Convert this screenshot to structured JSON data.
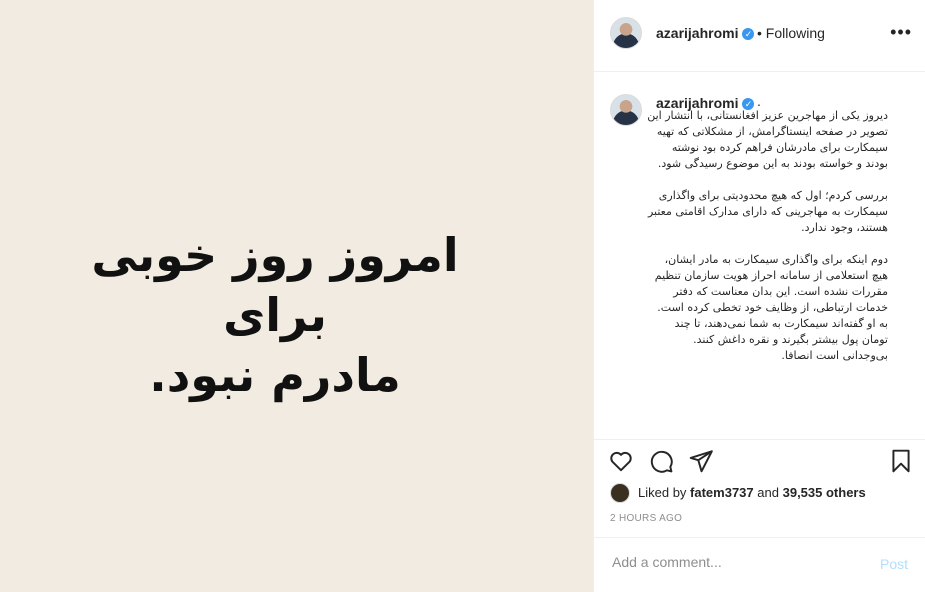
{
  "image": {
    "lines": [
      "امروز روز خوبی برای",
      "مادرم نبود."
    ],
    "background": "#f1ebe1"
  },
  "header": {
    "username": "azarijahromi",
    "separator": "•",
    "follow_state": "Following",
    "more_icon": "ellipsis-icon"
  },
  "caption": {
    "username": "azarijahromi",
    "dot": ".",
    "paragraphs": [
      "دیروز یکی از مهاجرین عزیز افغانستانی، با انتشار این تصویر در صفحه اینستاگرامش، از مشکلاتی که تهیه سیمکارت برای مادرشان فراهم کرده بود نوشته بودند و خواسته بودند به این موضوع رسیدگی شود.",
      "بررسی کردم؛ اول که هیچ محدودیتی برای واگذاری سیمکارت به مهاجرینی که دارای مدارک اقامتی معتبر هستند، وجود ندارد.",
      "دوم اینکه برای واگذاری سیمکارت به مادر ایشان، هیچ استعلامی از سامانه احراز هویت سازمان تنظیم مقررات نشده است. این بدان معناست که دفتر خدمات ارتباطی، از وظایف خود تخطی کرده است. به او گفته‌اند سیمکارت به شما نمی‌دهند، تا چند تومان پول بیشتر بگیرند و نقره داغش کنند. بی‌وجدانی است انصافا."
    ]
  },
  "actions": {
    "like_icon": "heart-icon",
    "comment_icon": "comment-icon",
    "share_icon": "share-icon",
    "save_icon": "bookmark-icon"
  },
  "likes": {
    "prefix": "Liked by",
    "user": "fatem3737",
    "and": "and",
    "others": "39,535 others"
  },
  "timestamp": "2 HOURS AGO",
  "comment": {
    "placeholder": "Add a comment...",
    "post_label": "Post"
  },
  "colors": {
    "verified": "#3897f0",
    "post_disabled": "#b2dffc",
    "muted": "#8e8e8e"
  }
}
